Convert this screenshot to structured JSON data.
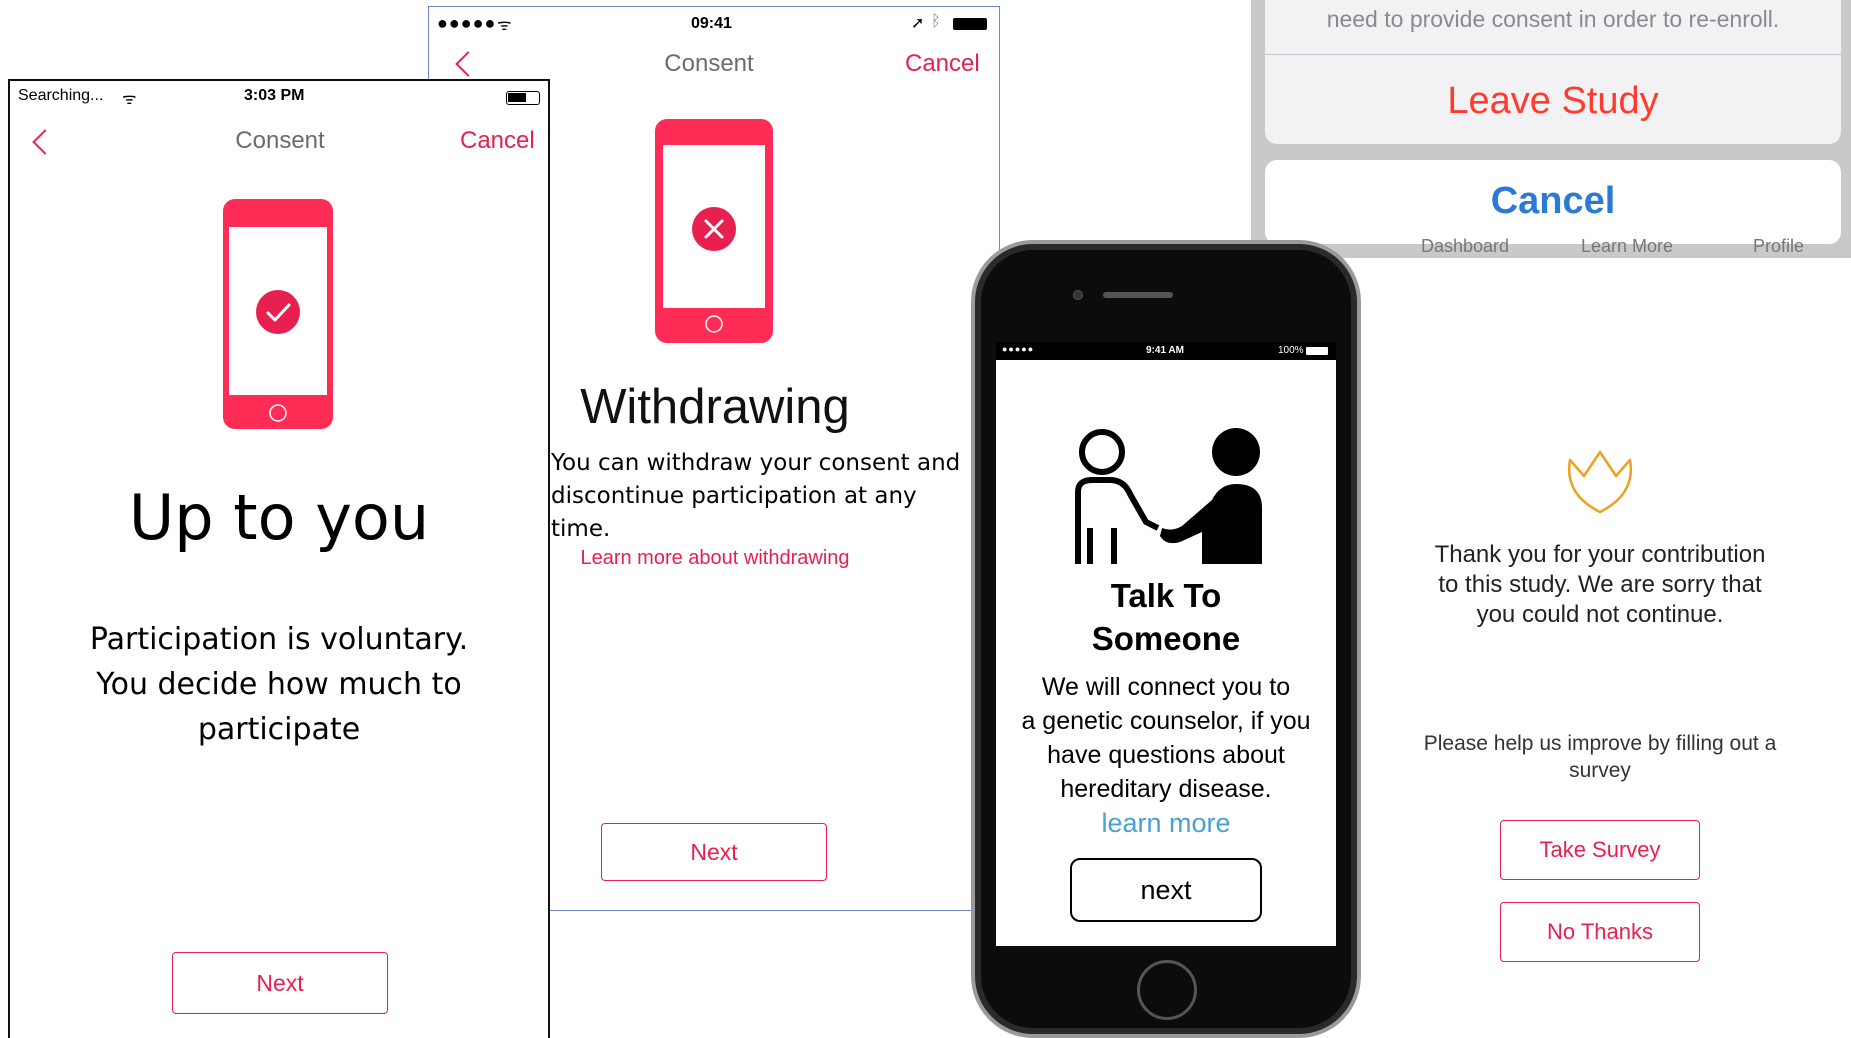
{
  "panel1": {
    "status": {
      "carrier": "Searching...",
      "time": "3:03 PM"
    },
    "nav": {
      "title": "Consent",
      "cancel": "Cancel"
    },
    "heading": "Up to you",
    "body_lines": [
      "Participation is voluntary.",
      "You decide how much to",
      "participate"
    ],
    "next": "Next"
  },
  "panel2": {
    "status": {
      "time": "09:41"
    },
    "nav": {
      "title": "Consent",
      "cancel": "Cancel"
    },
    "heading": "Withdrawing",
    "body_lines": [
      "You can withdraw your consent and",
      "discontinue participation at any time."
    ],
    "link": "Learn more about withdrawing",
    "next": "Next"
  },
  "panel3": {
    "message": "need to provide consent in order to re-enroll.",
    "leave": "Leave Study",
    "cancel": "Cancel",
    "tabs": [
      "Dashboard",
      "Learn More",
      "Profile"
    ]
  },
  "phone": {
    "status": {
      "time": "9:41 AM",
      "battery": "100%"
    },
    "title_lines": [
      "Talk To",
      "Someone"
    ],
    "body_lines": [
      "We will connect you to",
      "a genetic counselor, if you",
      "have questions about",
      "hereditary disease."
    ],
    "link": "learn more",
    "next": "next"
  },
  "panel4": {
    "thanks_lines": [
      "Thank you for your contribution",
      "to this study. We are sorry that",
      "you could not continue."
    ],
    "help_lines": [
      "Please help us improve by filling out a",
      "survey"
    ],
    "take_survey": "Take Survey",
    "no_thanks": "No Thanks"
  },
  "colors": {
    "accent": "#e8204f",
    "blue": "#2b7ad6",
    "orange": "#f0a020",
    "link_blue": "#4a9fd6"
  }
}
